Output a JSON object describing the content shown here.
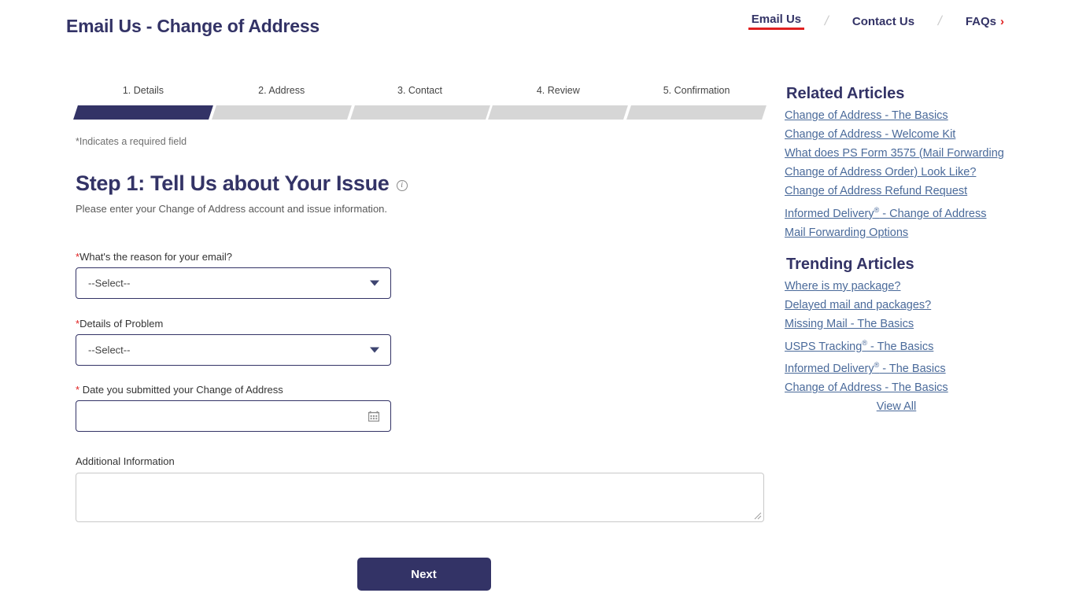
{
  "header": {
    "title": "Email Us - Change of Address",
    "nav": [
      {
        "label": "Email Us",
        "active": true
      },
      {
        "label": "Contact Us",
        "active": false
      },
      {
        "label": "FAQs",
        "active": false,
        "chevron": "›"
      }
    ],
    "separator": "/"
  },
  "stepper": {
    "steps": [
      {
        "label": "1. Details",
        "active": true
      },
      {
        "label": "2. Address",
        "active": false
      },
      {
        "label": "3. Contact",
        "active": false
      },
      {
        "label": "4. Review",
        "active": false
      },
      {
        "label": "5. Confirmation",
        "active": false
      }
    ],
    "active_color": "#333366",
    "inactive_color": "#d6d6d6"
  },
  "main": {
    "required_note": "*Indicates a required field",
    "heading": "Step 1: Tell Us about Your Issue",
    "info_icon_label": "i",
    "subheading": "Please enter your Change of Address account and issue information.",
    "fields": {
      "reason": {
        "label": "What's the reason for your email?",
        "required": true,
        "star": "*",
        "value": "--Select--"
      },
      "details": {
        "label": "Details of Problem",
        "required": true,
        "star": "*",
        "value": "--Select--"
      },
      "date": {
        "label": "Date you submitted your Change of Address",
        "required": true,
        "star": "*",
        "value": "",
        "placeholder": ""
      },
      "additional": {
        "label": "Additional Information",
        "required": false,
        "value": "",
        "placeholder": ""
      }
    },
    "next_label": "Next"
  },
  "sidebar": {
    "related_title": "Related Articles",
    "related_links": [
      "Change of Address - The Basics",
      "Change of Address - Welcome Kit",
      "What does PS Form 3575 (Mail Forwarding Change of Address Order) Look Like?",
      "Change of Address Refund Request",
      "Informed Delivery® - Change of Address",
      "Mail Forwarding Options"
    ],
    "trending_title": "Trending Articles",
    "trending_links": [
      "Where is my package?",
      "Delayed mail and packages?",
      "Missing Mail - The Basics",
      "USPS Tracking® - The Basics",
      "Informed Delivery® - The Basics",
      "Change of Address - The Basics"
    ],
    "view_all": "View All",
    "link_color": "#4a6a9a"
  }
}
